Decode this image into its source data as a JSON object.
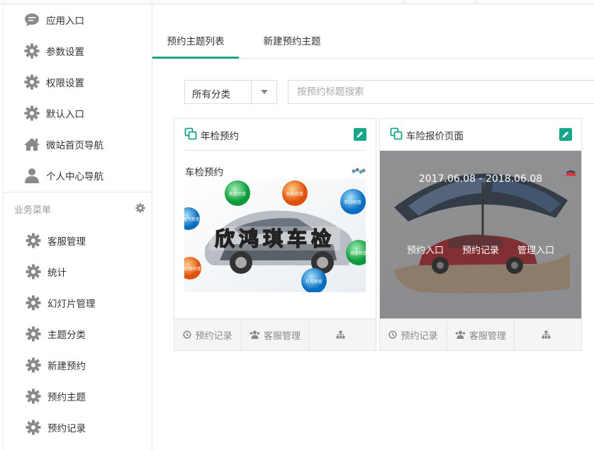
{
  "sidebar": {
    "items": [
      {
        "label": "应用入口",
        "icon": "chat-bubble-icon"
      },
      {
        "label": "参数设置",
        "icon": "gear-icon"
      },
      {
        "label": "权限设置",
        "icon": "gear-icon"
      },
      {
        "label": "默认入口",
        "icon": "gear-icon"
      },
      {
        "label": "微站首页导航",
        "icon": "home-icon"
      },
      {
        "label": "个人中心导航",
        "icon": "user-icon"
      }
    ],
    "section_title": "业务菜单",
    "business_items": [
      {
        "label": "客服管理",
        "icon": "gear-icon"
      },
      {
        "label": "统计",
        "icon": "gear-icon"
      },
      {
        "label": "幻灯片管理",
        "icon": "gear-icon"
      },
      {
        "label": "主题分类",
        "icon": "gear-icon"
      },
      {
        "label": "新建预约",
        "icon": "gear-icon"
      },
      {
        "label": "预约主题",
        "icon": "gear-icon"
      },
      {
        "label": "预约记录",
        "icon": "gear-icon"
      }
    ]
  },
  "tabs": [
    {
      "label": "预约主题列表",
      "active": true
    },
    {
      "label": "新建预约主题",
      "active": false
    }
  ],
  "filter": {
    "category_value": "所有分类",
    "search_placeholder": "按预约标题搜索"
  },
  "cards": [
    {
      "title": "年检预约",
      "subtitle": "车检预约",
      "image_text": "欣鸿琪车检",
      "bubbles": [
        "底盘检查",
        "轮胎检查",
        "制动检查",
        "排放检查",
        "尾气检查",
        "灯光检查",
        "机舱检查"
      ],
      "footer": {
        "records": "预约记录",
        "service": "客服管理"
      }
    },
    {
      "title": "车险报价页面",
      "date_range": "2017.06.08 - 2018.06.08",
      "overlay_links": [
        "预约入口",
        "预约记录",
        "管理入口"
      ],
      "footer": {
        "records": "预约记录",
        "service": "客服管理"
      }
    }
  ],
  "colors": {
    "accent": "#17a689",
    "icon_gray": "#8a8a8a"
  }
}
